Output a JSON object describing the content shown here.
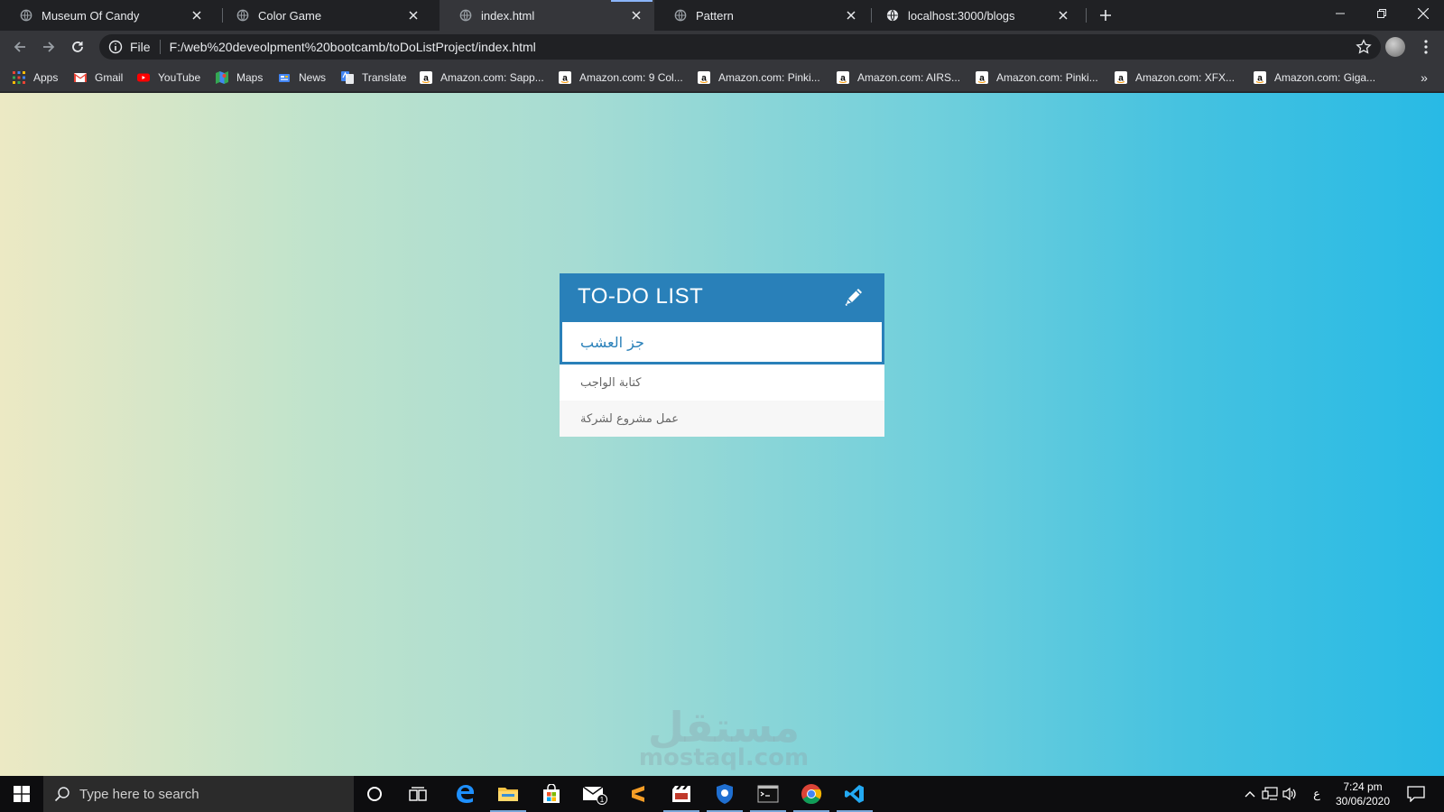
{
  "browser": {
    "tabs": [
      {
        "title": "Museum Of Candy",
        "favicon": "globe-icon",
        "active": false
      },
      {
        "title": "Color Game",
        "favicon": "globe-icon",
        "active": false
      },
      {
        "title": "index.html",
        "favicon": "globe-icon",
        "active": true
      },
      {
        "title": "Pattern",
        "favicon": "globe-icon",
        "active": false
      },
      {
        "title": "localhost:3000/blogs",
        "favicon": "globe-icon",
        "active": false
      }
    ],
    "omnibox": {
      "scheme": "File",
      "url": "F:/web%20deveolpment%20bootcamb/toDoListProject/index.html"
    },
    "bookmarks": [
      {
        "label": "Apps",
        "icon": "apps-grid-icon"
      },
      {
        "label": "Gmail",
        "icon": "gmail-icon"
      },
      {
        "label": "YouTube",
        "icon": "youtube-icon"
      },
      {
        "label": "Maps",
        "icon": "maps-icon"
      },
      {
        "label": "News",
        "icon": "news-icon"
      },
      {
        "label": "Translate",
        "icon": "translate-icon"
      },
      {
        "label": "Amazon.com: Sapp...",
        "icon": "amazon-icon"
      },
      {
        "label": "Amazon.com: 9 Col...",
        "icon": "amazon-icon"
      },
      {
        "label": "Amazon.com: Pinki...",
        "icon": "amazon-icon"
      },
      {
        "label": "Amazon.com: AIRS...",
        "icon": "amazon-icon"
      },
      {
        "label": "Amazon.com: Pinki...",
        "icon": "amazon-icon"
      },
      {
        "label": "Amazon.com: XFX...",
        "icon": "amazon-icon"
      },
      {
        "label": "Amazon.com: Giga...",
        "icon": "amazon-icon"
      }
    ],
    "more_bookmarks": "»"
  },
  "page": {
    "todo": {
      "title": "TO-DO LIST",
      "input_value": "جز العشب",
      "items": [
        "كتابة الواجب",
        "عمل مشروع لشركة"
      ]
    },
    "watermark": {
      "arabic": "مستقل",
      "latin": "mostaql.com"
    }
  },
  "taskbar": {
    "search_placeholder": "Type here to search",
    "apps": [
      "cortana-icon",
      "task-view-icon",
      "edge-icon",
      "file-explorer-icon",
      "store-icon",
      "mail-icon",
      "sublime-icon",
      "media-player-icon",
      "shield-app-icon",
      "terminal-icon",
      "chrome-icon",
      "vscode-icon"
    ],
    "mail_badge": "1",
    "keyboard_lang": "ع",
    "time": "7:24 pm",
    "date": "30/06/2020"
  },
  "colors": {
    "header_blue": "#2980b9",
    "item_text": "#666666",
    "gradient_left": "#ece9c4",
    "gradient_right": "#28bae5"
  }
}
